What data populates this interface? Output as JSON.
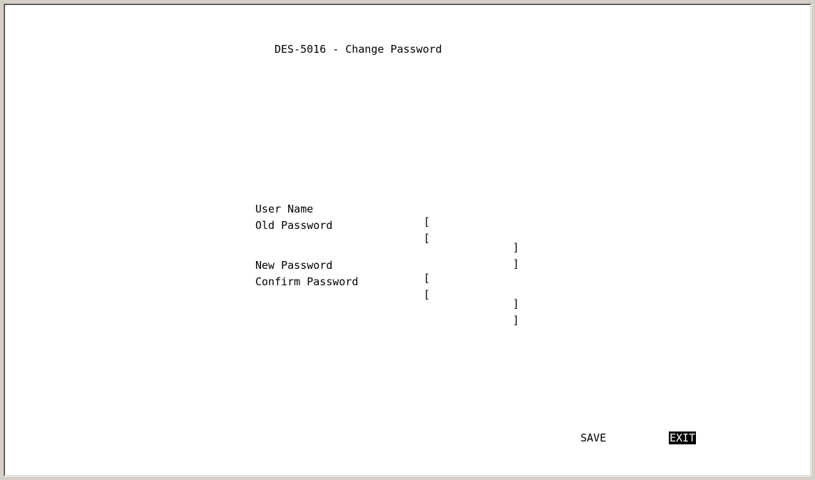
{
  "title": "DES-5016 - Change Password",
  "fields": [
    {
      "label": "User Name",
      "open": "[",
      "value": "",
      "close": "]"
    },
    {
      "label": "Old Password",
      "open": "[",
      "value": "",
      "close": "]"
    },
    {
      "label": "New Password",
      "open": "[",
      "value": "",
      "close": "]"
    },
    {
      "label": "Confirm Password",
      "open": "[",
      "value": "",
      "close": "]"
    }
  ],
  "actions": {
    "save": "SAVE",
    "exit": "EXIT",
    "selected": "exit"
  }
}
